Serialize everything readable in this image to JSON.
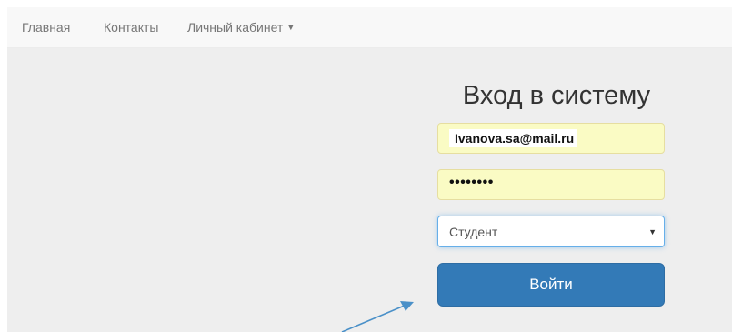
{
  "navbar": {
    "items": [
      {
        "label": "Главная"
      },
      {
        "label": "Контакты"
      },
      {
        "label": "Личный кабинет"
      }
    ]
  },
  "login": {
    "title": "Вход в систему",
    "email_value": "Ivanova.sa@mail.ru",
    "password_value": "••••••••",
    "role_selected": "Студент",
    "submit_label": "Войти"
  },
  "colors": {
    "navbar_bg": "#f8f8f8",
    "page_bg": "#eeeeee",
    "autofill_bg": "#fafbc4",
    "primary_button": "#337ab7",
    "focus_border": "#66afe9",
    "annotation_arrow": "#4a90c8"
  },
  "icons": {
    "dropdown": "caret-down-icon",
    "select": "select-arrow-icon",
    "annotation": "arrow-annotation"
  }
}
